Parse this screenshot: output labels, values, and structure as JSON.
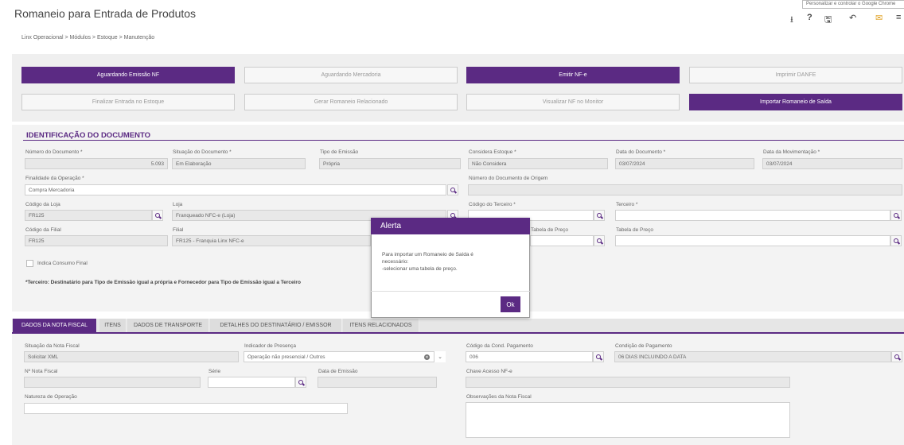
{
  "page": {
    "title": "Romaneio para Entrada de Produtos",
    "breadcrumb": "Linx Operacional  >  Módulos  >  Estoque  >  Manutenção",
    "tooltip": "Personalizar e controlar o Google Chrome"
  },
  "toolbar": {
    "icons": [
      "download-icon",
      "help-icon",
      "save-icon",
      "undo-icon",
      "mail-icon",
      "menu-icon"
    ],
    "glyphs": {
      "download": "⭳",
      "help": "?",
      "save": "🖫",
      "undo": "↶",
      "mail": "✉",
      "menu": "≡"
    }
  },
  "actions": [
    {
      "label": "Aguardando Emissão NF",
      "active": true
    },
    {
      "label": "Aguardando Mercadoria",
      "active": false
    },
    {
      "label": "Emitir NF-e",
      "active": true
    },
    {
      "label": "Imprimir DANFE",
      "active": false
    },
    {
      "label": "Finalizar Entrada no Estoque",
      "active": false
    },
    {
      "label": "Gerar Romaneio Relacionado",
      "active": false
    },
    {
      "label": "Visualizar NF no Monitor",
      "active": false
    },
    {
      "label": "Importar Romaneio de Saída",
      "active": true
    }
  ],
  "section": {
    "title": "IDENTIFICAÇÃO DO DOCUMENTO"
  },
  "fields": {
    "numero_documento": {
      "label": "Número do Documento *",
      "value": "5.093"
    },
    "situacao_documento": {
      "label": "Situação do Documento *",
      "value": "Em Elaboração"
    },
    "tipo_emissao": {
      "label": "Tipo de Emissão",
      "value": "Própria"
    },
    "considera_estoque": {
      "label": "Considera Estoque *",
      "value": "Não Considera"
    },
    "data_documento": {
      "label": "Data do Documento *",
      "value": "03/07/2024"
    },
    "data_movimentacao": {
      "label": "Data da Movimentação *",
      "value": "03/07/2024"
    },
    "finalidade_operacao": {
      "label": "Finalidade da Operação *",
      "value": "Compra Mercadoria"
    },
    "numero_documento_origem": {
      "label": "Número do Documento de Origem",
      "value": ""
    },
    "codigo_loja": {
      "label": "Código da Loja",
      "value": "FR125"
    },
    "loja": {
      "label": "Loja",
      "value": "Franqueado NFC-e (Loja)"
    },
    "codigo_terceiro": {
      "label": "Código do Terceiro *",
      "value": ""
    },
    "terceiro": {
      "label": "Terceiro *",
      "value": ""
    },
    "codigo_filial": {
      "label": "Código da Filial",
      "value": "FR125"
    },
    "filial": {
      "label": "Filial",
      "value": "FR125 - Franquia Linx NFC-e"
    },
    "codigo_tabela_preco": {
      "label": "Código da Tabela de Preço",
      "value": ""
    },
    "tabela_preco": {
      "label": "Tabela de Preço",
      "value": ""
    },
    "indica_consumo_final": {
      "label": "Indica Consumo Final"
    },
    "note": "*Terceiro: Destinatário para Tipo de Emissão igual a própria e Fornecedor para Tipo de Emissão igual a Terceiro"
  },
  "tabs": [
    {
      "label": "DADOS DA NOTA FISCAL",
      "active": true
    },
    {
      "label": "ITENS",
      "active": false
    },
    {
      "label": "DADOS DE TRANSPORTE",
      "active": false
    },
    {
      "label": "DETALHES DO DESTINATÁRIO / EMISSOR",
      "active": false
    },
    {
      "label": "ITENS RELACIONADOS",
      "active": false
    }
  ],
  "nf": {
    "situacao": {
      "label": "Situação da Nota Fiscal",
      "value": "Solicitar XML"
    },
    "indicador_presenca": {
      "label": "Indicador de Presença",
      "value": "Operação não presencial / Outros"
    },
    "codigo_cond_pagamento": {
      "label": "Código da Cond. Pagamento",
      "value": "006"
    },
    "condicao_pagamento": {
      "label": "Condição de Pagamento",
      "value": "06 DIAS INCLUINDO A DATA"
    },
    "numero_nf": {
      "label": "Nº Nota Fiscal",
      "value": ""
    },
    "serie": {
      "label": "Série",
      "value": ""
    },
    "data_emissao": {
      "label": "Data de Emissão",
      "value": ""
    },
    "chave_acesso": {
      "label": "Chave Acesso NF-e",
      "value": ""
    },
    "natureza_operacao": {
      "label": "Natureza de Operação",
      "value": ""
    },
    "observacoes": {
      "label": "Observações da Nota Fiscal",
      "value": ""
    }
  },
  "modal": {
    "title": "Alerta",
    "line1": "Para importar um Romaneio de Saída é",
    "line2": "necessário:",
    "line3": "-selecionar uma tabela de preço.",
    "ok": "Ok"
  }
}
